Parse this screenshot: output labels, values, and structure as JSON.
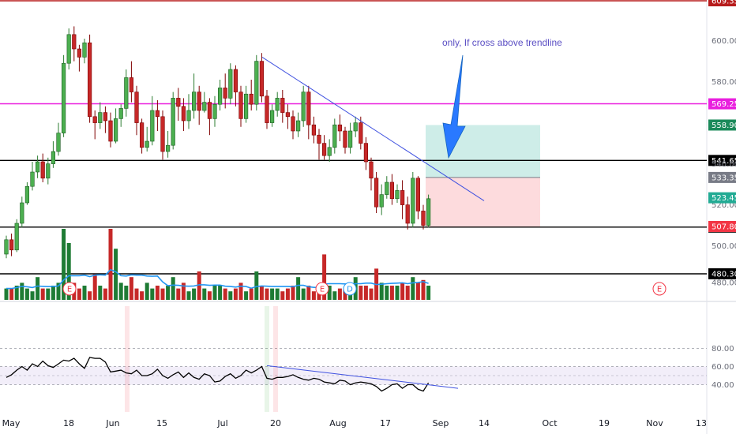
{
  "chart_data": {
    "type": "candlestick",
    "price_axis": {
      "range": [
        490,
        610
      ],
      "ticks": [
        480,
        500,
        520,
        540,
        560,
        580,
        600
      ],
      "tick_labels": [
        "480.00",
        "500.00",
        "520.00",
        "540.00",
        "560.00",
        "580.00",
        "600.00"
      ]
    },
    "x_axis": {
      "tick_labels": [
        "May",
        "18",
        "Jun",
        "15",
        "Jul",
        "20",
        "Aug",
        "17",
        "Sep",
        "14",
        "Oct",
        "19",
        "Nov",
        "13"
      ]
    },
    "candles": [
      [
        496,
        503,
        494,
        505
      ],
      [
        503,
        498,
        495,
        506
      ],
      [
        498,
        511,
        497,
        513
      ],
      [
        511,
        521,
        509,
        524
      ],
      [
        521,
        529,
        520,
        531
      ],
      [
        529,
        536,
        527,
        541
      ],
      [
        536,
        541,
        533,
        544
      ],
      [
        541,
        533,
        531,
        545
      ],
      [
        533,
        540,
        530,
        543
      ],
      [
        540,
        546,
        538,
        551
      ],
      [
        546,
        555,
        544,
        560
      ],
      [
        555,
        589,
        553,
        593
      ],
      [
        589,
        603,
        586,
        606
      ],
      [
        603,
        596,
        590,
        607
      ],
      [
        596,
        592,
        585,
        598
      ],
      [
        592,
        599,
        589,
        601
      ],
      [
        599,
        563,
        560,
        603
      ],
      [
        563,
        560,
        552,
        566
      ],
      [
        560,
        565,
        557,
        570
      ],
      [
        565,
        561,
        555,
        568
      ],
      [
        561,
        551,
        548,
        565
      ],
      [
        551,
        562,
        550,
        567
      ],
      [
        562,
        567,
        558,
        569
      ],
      [
        567,
        582,
        563,
        586
      ],
      [
        582,
        575,
        570,
        590
      ],
      [
        575,
        560,
        554,
        578
      ],
      [
        560,
        548,
        545,
        562
      ],
      [
        548,
        551,
        546,
        558
      ],
      [
        551,
        566,
        549,
        573
      ],
      [
        566,
        563,
        556,
        571
      ],
      [
        563,
        546,
        542,
        566
      ],
      [
        546,
        549,
        543,
        556
      ],
      [
        549,
        572,
        547,
        575
      ],
      [
        572,
        568,
        561,
        577
      ],
      [
        568,
        561,
        556,
        572
      ],
      [
        561,
        566,
        557,
        574
      ],
      [
        566,
        575,
        562,
        584
      ],
      [
        575,
        566,
        559,
        578
      ],
      [
        566,
        570,
        565,
        575
      ],
      [
        570,
        562,
        554,
        572
      ],
      [
        562,
        569,
        558,
        573
      ],
      [
        569,
        577,
        566,
        581
      ],
      [
        577,
        572,
        567,
        584
      ],
      [
        572,
        586,
        569,
        589
      ],
      [
        586,
        575,
        568,
        588
      ],
      [
        575,
        562,
        558,
        578
      ],
      [
        562,
        574,
        560,
        578
      ],
      [
        574,
        569,
        566,
        581
      ],
      [
        569,
        590,
        566,
        593
      ],
      [
        590,
        573,
        570,
        594
      ],
      [
        573,
        560,
        557,
        576
      ],
      [
        560,
        566,
        558,
        569
      ],
      [
        566,
        572,
        563,
        575
      ],
      [
        572,
        565,
        560,
        576
      ],
      [
        565,
        563,
        557,
        569
      ],
      [
        563,
        556,
        552,
        566
      ],
      [
        556,
        561,
        553,
        565
      ],
      [
        561,
        575,
        558,
        578
      ],
      [
        575,
        559,
        552,
        578
      ],
      [
        559,
        554,
        550,
        563
      ],
      [
        554,
        550,
        542,
        557
      ],
      [
        550,
        544,
        542,
        554
      ],
      [
        544,
        548,
        541,
        552
      ],
      [
        548,
        559,
        545,
        562
      ],
      [
        559,
        556,
        551,
        564
      ],
      [
        556,
        548,
        545,
        558
      ],
      [
        548,
        556,
        545,
        560
      ],
      [
        556,
        560,
        553,
        563
      ],
      [
        560,
        550,
        547,
        563
      ],
      [
        550,
        541,
        537,
        553
      ],
      [
        541,
        533,
        527,
        543
      ],
      [
        533,
        519,
        516,
        536
      ],
      [
        519,
        525,
        515,
        530
      ],
      [
        525,
        531,
        523,
        534
      ],
      [
        531,
        523,
        520,
        535
      ],
      [
        523,
        527,
        521,
        530
      ],
      [
        527,
        520,
        513,
        532
      ],
      [
        520,
        511,
        508,
        524
      ],
      [
        511,
        533,
        509,
        536
      ],
      [
        533,
        517,
        513,
        534
      ],
      [
        517,
        510,
        508,
        520
      ],
      [
        510,
        523,
        509,
        525
      ]
    ],
    "volume": [
      4,
      4,
      5,
      6,
      4,
      3,
      8,
      4,
      4,
      5,
      6,
      25,
      20,
      6,
      4,
      5,
      3,
      9,
      5,
      4,
      25,
      18,
      6,
      5,
      8,
      4,
      3,
      6,
      4,
      5,
      4,
      5,
      8,
      4,
      6,
      3,
      4,
      10,
      4,
      3,
      5,
      5,
      4,
      3,
      4,
      6,
      3,
      4,
      10,
      5,
      4,
      4,
      4,
      3,
      4,
      5,
      8,
      4,
      5,
      3,
      4,
      16,
      5,
      3,
      4,
      4,
      5,
      8,
      5,
      5,
      4,
      11,
      6,
      5,
      5,
      5,
      6,
      5,
      8,
      6,
      7,
      5
    ],
    "rsi": [
      48,
      51,
      56,
      60,
      56,
      63,
      60,
      66,
      61,
      59,
      63,
      67,
      66,
      69,
      63,
      58,
      70,
      69,
      69,
      65,
      54,
      55,
      56,
      53,
      52,
      56,
      50,
      50,
      52,
      57,
      50,
      47,
      51,
      54,
      48,
      53,
      48,
      46,
      52,
      50,
      43,
      44,
      49,
      52,
      47,
      50,
      56,
      53,
      56,
      60,
      47,
      46,
      48,
      48,
      49,
      51,
      48,
      46,
      45,
      47,
      46,
      43,
      42,
      41,
      45,
      44,
      40,
      42,
      43,
      42,
      41,
      38,
      33,
      36,
      40,
      41,
      36,
      40,
      40,
      35,
      33,
      42
    ],
    "rsi_axis": {
      "range": [
        25,
        90
      ],
      "tick_labels": [
        "40.00",
        "60.00",
        "80.00"
      ]
    },
    "horizontal_levels": [
      {
        "price": 609.35,
        "label": "609.35",
        "color": "#b71c1c"
      },
      {
        "price": 569.25,
        "label": "569.25",
        "color": "#e91ede"
      },
      {
        "price": 541.65,
        "label": "541.65",
        "color": "#000000"
      },
      {
        "price": 509.15,
        "label": "509.15",
        "color": "#000000"
      },
      {
        "price": 480.3,
        "label": "480.30",
        "color": "#000000"
      }
    ],
    "price_tags": [
      {
        "price": 558.9,
        "label": "558.90",
        "bg": "#1b8a5a",
        "fg": "#ffffff"
      },
      {
        "price": 533.35,
        "label": "533.35",
        "bg": "#787b86",
        "fg": "#ffffff"
      },
      {
        "price": 523.45,
        "label": "523.45",
        "bg": "#22ab94",
        "fg": "#ffffff"
      },
      {
        "price": 507.8,
        "label": "507.80",
        "bg": "#f23645",
        "fg": "#ffffff"
      }
    ],
    "position_tool": {
      "entry": 533.35,
      "target": 558.9,
      "stop": 509.15
    },
    "trendline_price": {
      "from": [
        332,
        592
      ],
      "to": [
        613,
        522
      ]
    },
    "trendline_rsi": {
      "from": [
        338,
        61
      ],
      "to": [
        580,
        36
      ]
    },
    "event_markers": [
      {
        "label": "E",
        "color": "#f23645"
      },
      {
        "label": "E",
        "color": "#f23645"
      },
      {
        "label": "D",
        "color": "#2196f3"
      },
      {
        "label": "E",
        "color": "#f23645"
      }
    ],
    "annotation": "only, If cross above trendline",
    "colors": {
      "up": "#4caf50",
      "down": "#c62828",
      "up_border": "#1b5e20",
      "down_border": "#7f0000",
      "volume_up": "#1e7b34",
      "volume_down": "#c62828",
      "volume_ma": "#2196f3",
      "rsi_band": "#7e57c2"
    }
  }
}
